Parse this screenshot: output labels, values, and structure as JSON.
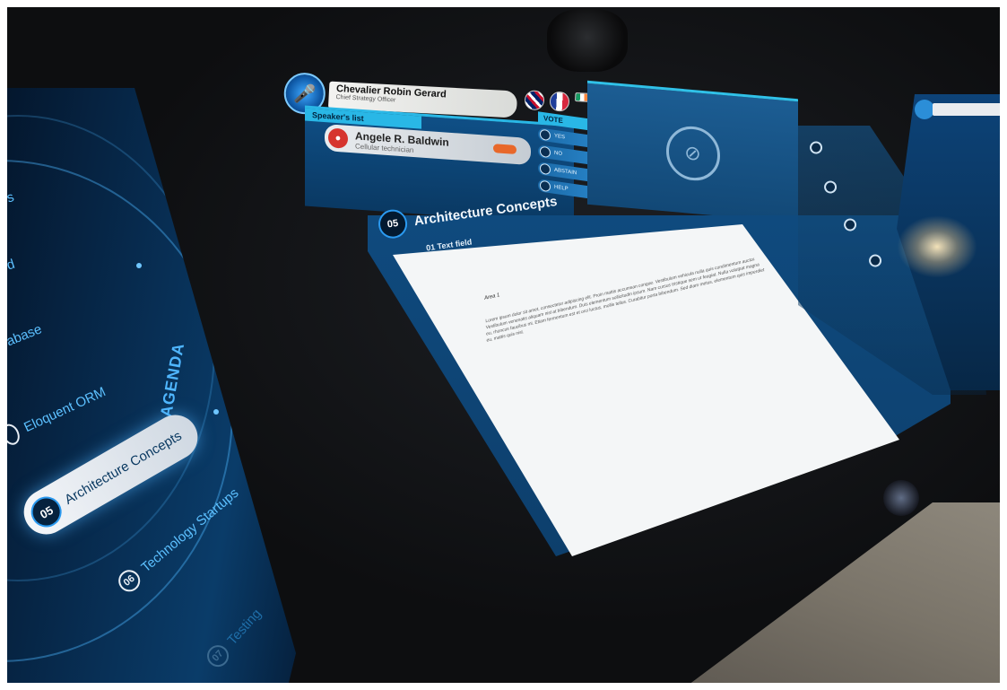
{
  "agenda": {
    "title": "AGENDA",
    "items": [
      {
        "num": "",
        "label": "s"
      },
      {
        "num": "",
        "label": "d"
      },
      {
        "num": "",
        "label": "abase"
      },
      {
        "num": "",
        "label": "Eloquent ORM"
      },
      {
        "num": "05",
        "label": "Architecture Concepts",
        "active": true
      },
      {
        "num": "06",
        "label": "Technology Startups"
      },
      {
        "num": "07",
        "label": "Testing"
      }
    ]
  },
  "speaker": {
    "name": "Chevalier Robin Gerard",
    "role": "Chief Strategy Officer"
  },
  "speakers_list": {
    "header": "Speaker's list",
    "entry_name": "Angele R. Baldwin",
    "entry_role": "Cellular technician"
  },
  "vote": {
    "header": "VOTE",
    "buttons": [
      "YES",
      "NO",
      "ABSTAIN",
      "HELP"
    ]
  },
  "document": {
    "number": "05",
    "title": "Architecture Concepts",
    "subtitle": "01  Text field",
    "heading": "Area 1",
    "body": "Lorem ipsum dolor sit amet, consectetur adipiscing elit. Proin mattis accumsan congue. Vestibulum vehicula nulla quis condimentum auctor. Vestibulum venenatis aliquam nisl at bibendum. Duis elementum sollicitudin ipsum. Nam cursus tristique sem ut feugiat. Nulla volutpat magna eu, rhoncus faucibus mi. Etiam fermentum est et orci luctus, mollis tellus. Curabitur porta bibendum. Sed diam metus, elementum quis imperdiet eu, mattis quis nisl."
  },
  "colors": {
    "accent": "#29b7e6",
    "panel": "#0f4a7e",
    "active_item": "#f4f6f9",
    "alert": "#d6342e"
  }
}
